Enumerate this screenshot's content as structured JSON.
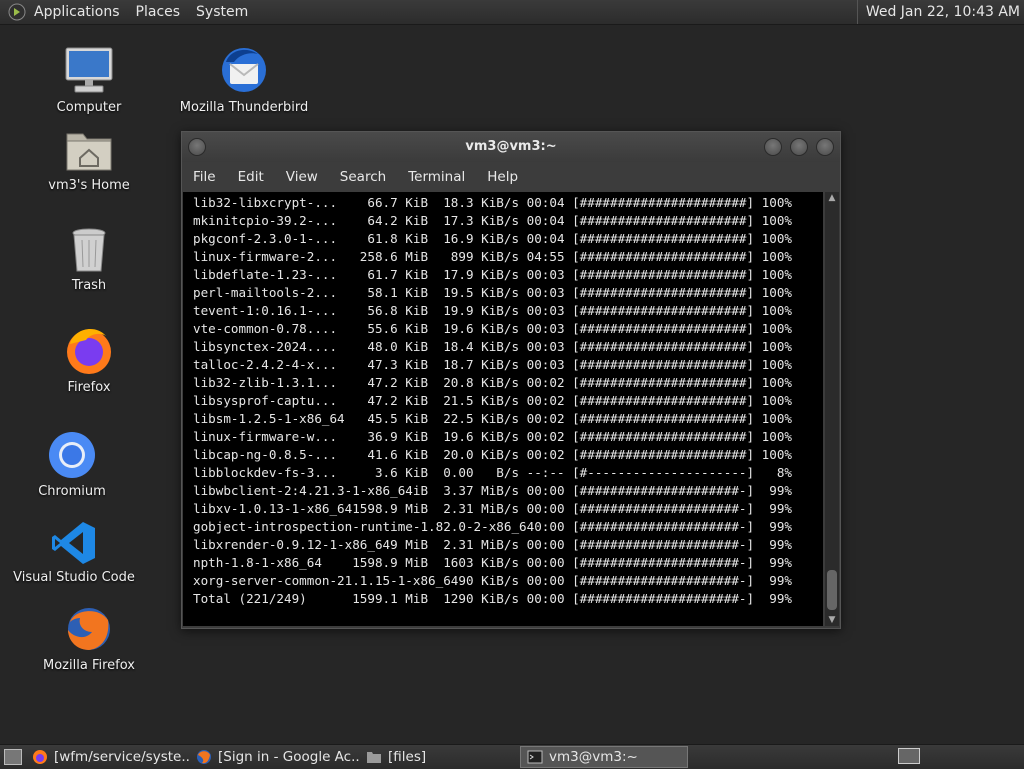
{
  "top_panel": {
    "menus": [
      "Applications",
      "Places",
      "System"
    ],
    "clock": "Wed Jan 22, 10:43 AM"
  },
  "desktop": {
    "icons": [
      {
        "label": "Computer",
        "icon": "computer-icon"
      },
      {
        "label": "vm3's Home",
        "icon": "home-folder-icon"
      },
      {
        "label": "Trash",
        "icon": "trash-icon"
      },
      {
        "label": "Firefox",
        "icon": "firefox-icon"
      },
      {
        "label": "Chromium",
        "icon": "chromium-icon"
      },
      {
        "label": "Visual Studio Code",
        "icon": "vscode-icon"
      },
      {
        "label": "Mozilla Firefox",
        "icon": "mozilla-firefox-icon"
      },
      {
        "label": "Mozilla Thunderbird",
        "icon": "thunderbird-icon"
      }
    ]
  },
  "terminal": {
    "title": "vm3@vm3:~",
    "menu": [
      "File",
      "Edit",
      "View",
      "Search",
      "Terminal",
      "Help"
    ],
    "lines": [
      "lib32-libxcrypt-...    66.7 KiB  18.3 KiB/s 00:04 [######################] 100%",
      "mkinitcpio-39.2-...    64.2 KiB  17.3 KiB/s 00:04 [######################] 100%",
      "pkgconf-2.3.0-1-...    61.8 KiB  16.9 KiB/s 00:04 [######################] 100%",
      "linux-firmware-2...   258.6 MiB   899 KiB/s 04:55 [######################] 100%",
      "libdeflate-1.23-...    61.7 KiB  17.9 KiB/s 00:03 [######################] 100%",
      "perl-mailtools-2...    58.1 KiB  19.5 KiB/s 00:03 [######################] 100%",
      "tevent-1:0.16.1-...    56.8 KiB  19.9 KiB/s 00:03 [######################] 100%",
      "vte-common-0.78....    55.6 KiB  19.6 KiB/s 00:03 [######################] 100%",
      "libsynctex-2024....    48.0 KiB  18.4 KiB/s 00:03 [######################] 100%",
      "talloc-2.4.2-4-x...    47.3 KiB  18.7 KiB/s 00:03 [######################] 100%",
      "lib32-zlib-1.3.1...    47.2 KiB  20.8 KiB/s 00:02 [######################] 100%",
      "libsysprof-captu...    47.2 KiB  21.5 KiB/s 00:02 [######################] 100%",
      "libsm-1.2.5-1-x86_64   45.5 KiB  22.5 KiB/s 00:02 [######################] 100%",
      "linux-firmware-w...    36.9 KiB  19.6 KiB/s 00:02 [######################] 100%",
      "libcap-ng-0.8.5-...    41.6 KiB  20.0 KiB/s 00:02 [######################] 100%",
      "libblockdev-fs-3...     3.6 KiB  0.00   B/s --:-- [#---------------------]   8%",
      "libwbclient-2:4.21.3-1-x86_64iB  3.37 MiB/s 00:00 [#####################-]  99%",
      "libxv-1.0.13-1-x86_641598.9 MiB  2.31 MiB/s 00:00 [#####################-]  99%",
      "gobject-introspection-runtime-1.82.0-2-x86_640:00 [#####################-]  99%",
      "libxrender-0.9.12-1-x86_649 MiB  2.31 MiB/s 00:00 [#####################-]  99%",
      "npth-1.8-1-x86_64    1598.9 MiB  1603 KiB/s 00:00 [#####################-]  99%",
      "xorg-server-common-21.1.15-1-x86_6490 KiB/s 00:00 [#####################-]  99%",
      "Total (221/249)      1599.1 MiB  1290 KiB/s 00:00 [#####################-]  99%"
    ]
  },
  "taskbar": {
    "tasks": [
      {
        "label": "[wfm/service/syste...",
        "icon": "firefox-icon",
        "active": false
      },
      {
        "label": "[Sign in - Google Ac...",
        "icon": "mozilla-firefox-icon",
        "active": false
      },
      {
        "label": "[files]",
        "icon": "folder-icon",
        "active": false
      },
      {
        "label": "vm3@vm3:~",
        "icon": "terminal-icon",
        "active": true
      }
    ]
  }
}
